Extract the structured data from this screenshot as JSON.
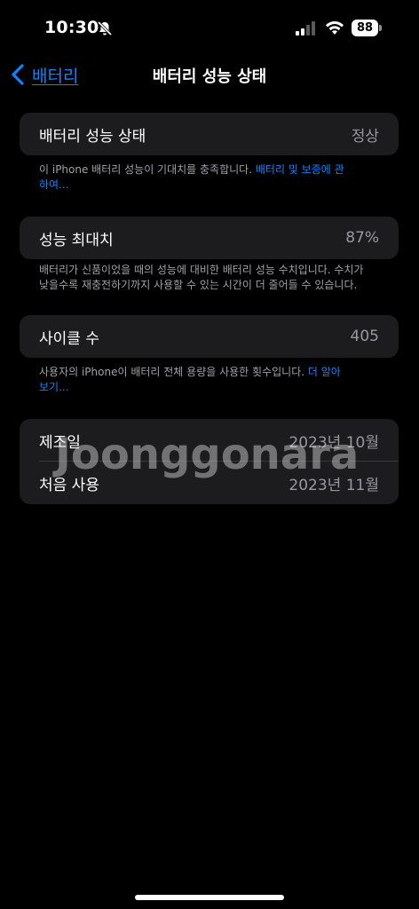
{
  "status_bar": {
    "time": "10:30",
    "battery_level": "88",
    "icons": [
      "bell-slash-icon",
      "signal-icon",
      "wifi-icon",
      "battery-icon"
    ]
  },
  "nav": {
    "back_label": "배터리",
    "title": "배터리 성능 상태"
  },
  "health": {
    "label": "배터리 성능 상태",
    "value": "정상",
    "footnote_text": "이 iPhone 배터리 성능이 기대치를 충족합니다. ",
    "footnote_link": "배터리 및 보증에 관하여..."
  },
  "capacity": {
    "label": "성능 최대치",
    "value": "87%",
    "footnote": "배터리가 신품이었을 때의 성능에 대비한 배터리 성능 수치입니다. 수치가 낮을수록 재충전하기까지 사용할 수 있는 시간이 더 줄어들 수 있습니다."
  },
  "cycle": {
    "label": "사이클 수",
    "value": "405",
    "footnote_text": "사용자의 iPhone이 배터리 전체 용량을 사용한 횟수입니다. ",
    "footnote_link": "더 알아보기..."
  },
  "dates": {
    "manufacture_label": "제조일",
    "manufacture_value": "2023년 10월",
    "first_use_label": "처음 사용",
    "first_use_value": "2023년 11월"
  },
  "watermark": "Joonggonara",
  "colors": {
    "background": "#000000",
    "card": "#1c1c1e",
    "accent": "#0a84ff",
    "secondary_text": "#98989f"
  }
}
